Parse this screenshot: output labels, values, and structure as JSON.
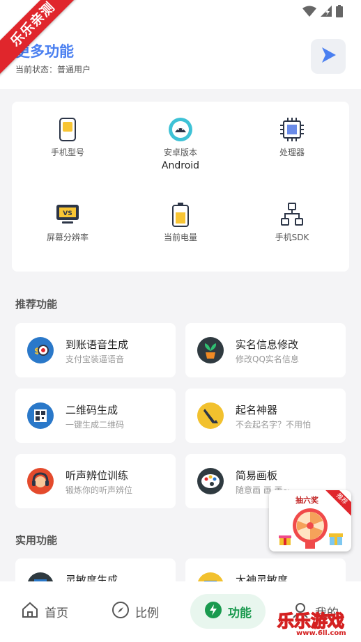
{
  "ribbon": {
    "text": "乐乐亲测"
  },
  "header": {
    "title": "更多功能",
    "status_label": "当前状态：",
    "status_value": "普通用户"
  },
  "device_info": [
    {
      "label": "手机型号",
      "value": "",
      "icon": "phone-icon"
    },
    {
      "label": "安卓版本",
      "value": "Android",
      "icon": "android-icon"
    },
    {
      "label": "处理器",
      "value": "",
      "icon": "cpu-icon"
    },
    {
      "label": "屏幕分辨率",
      "value": "",
      "icon": "screen-icon"
    },
    {
      "label": "当前电量",
      "value": "",
      "icon": "battery-icon"
    },
    {
      "label": "手机SDK",
      "value": "",
      "icon": "sdk-icon"
    }
  ],
  "sections": {
    "recommended": "推荐功能",
    "practical": "实用功能"
  },
  "recommended": [
    {
      "title": "到账语音生成",
      "subtitle": "支付宝装逼语音",
      "icon": "payment-voice-icon"
    },
    {
      "title": "实名信息修改",
      "subtitle": "修改QQ实名信息",
      "icon": "plant-icon"
    },
    {
      "title": "二维码生成",
      "subtitle": "一键生成二维码",
      "icon": "qrcode-icon"
    },
    {
      "title": "起名神器",
      "subtitle": "不会起名字？不用怕",
      "icon": "brush-icon"
    },
    {
      "title": "听声辨位训练",
      "subtitle": "锻炼你的听声辨位",
      "icon": "headphone-icon"
    },
    {
      "title": "简易画板",
      "subtitle": "随意画 画 画~",
      "icon": "palette-icon"
    }
  ],
  "practical": [
    {
      "title": "灵敏度生成",
      "icon": "sensitivity-icon"
    },
    {
      "title": "大神灵敏度",
      "icon": "folder-icon"
    }
  ],
  "promo": {
    "title": "抽六奖",
    "tag": "推荐"
  },
  "nav": [
    {
      "label": "首页",
      "icon": "home-icon"
    },
    {
      "label": "比例",
      "icon": "compass-icon"
    },
    {
      "label": "功能",
      "icon": "bolt-icon"
    },
    {
      "label": "我的",
      "icon": "user-icon"
    }
  ],
  "watermark": {
    "text": "乐乐游戏",
    "url": "www.6ll.com"
  }
}
